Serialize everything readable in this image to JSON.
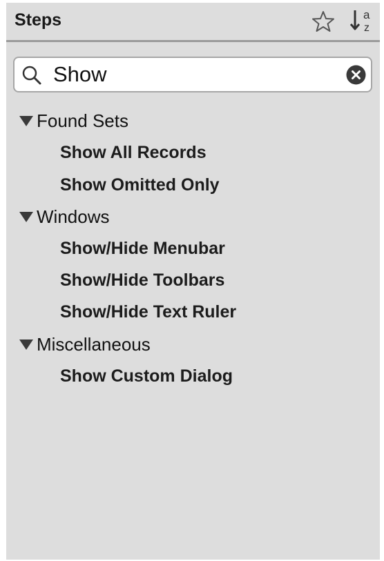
{
  "header": {
    "title": "Steps",
    "favorite_icon": "star-outline-icon",
    "sort_icon": "sort-a-z-icon"
  },
  "search": {
    "value": "Show",
    "placeholder": "",
    "search_icon": "magnifier-icon",
    "clear_icon": "clear-circle-x-icon"
  },
  "tree": {
    "groups": [
      {
        "label": "Found Sets",
        "expanded": true,
        "items": [
          {
            "label": "Show All Records"
          },
          {
            "label": "Show Omitted Only"
          }
        ]
      },
      {
        "label": "Windows",
        "expanded": true,
        "items": [
          {
            "label": "Show/Hide Menubar"
          },
          {
            "label": "Show/Hide Toolbars"
          },
          {
            "label": "Show/Hide Text Ruler"
          }
        ]
      },
      {
        "label": "Miscellaneous",
        "expanded": true,
        "items": [
          {
            "label": "Show Custom Dialog"
          }
        ]
      }
    ]
  },
  "colors": {
    "panel_background": "#dddddd",
    "divider": "#9a9a9a",
    "search_border": "#a6a6a6",
    "text": "#111111",
    "clear_button": "#3a3a3a"
  }
}
